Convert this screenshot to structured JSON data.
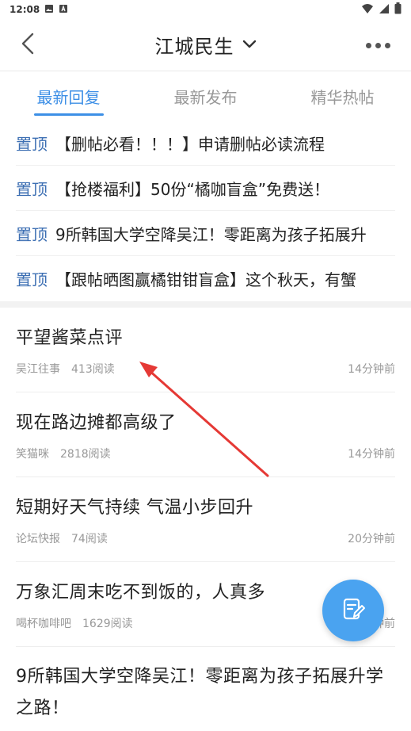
{
  "status_bar": {
    "time": "12:08"
  },
  "header": {
    "title": "江城民生"
  },
  "tabs": [
    {
      "label": "最新回复",
      "active": true
    },
    {
      "label": "最新发布",
      "active": false
    },
    {
      "label": "精华热帖",
      "active": false
    }
  ],
  "pinned": [
    {
      "tag": "置顶",
      "title": "【删帖必看！！！】申请删帖必读流程"
    },
    {
      "tag": "置顶",
      "title": "【抢楼福利】50份“橘咖盲盒”免费送！"
    },
    {
      "tag": "置顶",
      "title": "9所韩国大学空降吴江！零距离为孩子拓展升"
    },
    {
      "tag": "置顶",
      "title": "【跟帖晒图赢橘钳钳盲盒】这个秋天，有蟹"
    }
  ],
  "posts": [
    {
      "title": "平望酱菜点评",
      "author": "吴江往事",
      "reads": "413阅读",
      "time": "14分钟前"
    },
    {
      "title": "现在路边摊都高级了",
      "author": "笑猫咪",
      "reads": "2818阅读",
      "time": "14分钟前"
    },
    {
      "title": "短期好天气持续 气温小步回升",
      "author": "论坛快报",
      "reads": "74阅读",
      "time": "20分钟前"
    },
    {
      "title": "万象汇周末吃不到饭的，人真多",
      "author": "喝杯咖啡吧",
      "reads": "1629阅读",
      "time": "分钟前"
    },
    {
      "title": "9所韩国大学空降吴江！零距离为孩子拓展升学之路！"
    }
  ],
  "colors": {
    "accent": "#3d8fe6",
    "pin_tag": "#3d6fb3",
    "fab": "#4aa3f0",
    "annotation_arrow": "#e53935"
  },
  "icons": {
    "back": "chevron-left-icon",
    "title_dropdown": "chevron-down-icon",
    "more": "more-dots-icon",
    "compose": "edit-note-icon"
  }
}
